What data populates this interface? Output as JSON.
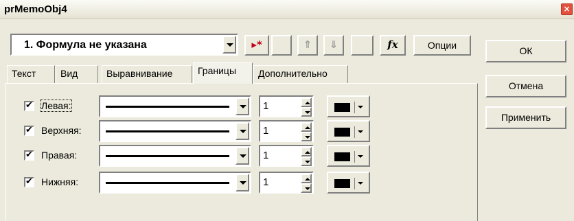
{
  "window": {
    "title": "prMemoObj4",
    "close_glyph": "×"
  },
  "formula": {
    "selected": "1.  Формула не указана"
  },
  "toolbar": {
    "buttons": [
      {
        "name": "insert-formula-icon",
        "glyph": "▸*"
      },
      {
        "name": "blank-button-1",
        "glyph": ""
      },
      {
        "name": "move-up-icon",
        "glyph": "⇑"
      },
      {
        "name": "move-down-icon",
        "glyph": "⇓"
      },
      {
        "name": "blank-button-2",
        "glyph": ""
      },
      {
        "name": "function-icon",
        "glyph": "fx"
      }
    ],
    "options_label": "Опции"
  },
  "side_buttons": {
    "ok": "ОК",
    "cancel": "Отмена",
    "apply": "Применить"
  },
  "tabs": [
    "Текст",
    "Вид",
    "Выравнивание",
    "Границы",
    "Дополнительно"
  ],
  "active_tab": "Границы",
  "borders": [
    {
      "label": "Левая:",
      "checked": true,
      "width": "1",
      "color": "#000000"
    },
    {
      "label": "Верхняя:",
      "checked": true,
      "width": "1",
      "color": "#000000"
    },
    {
      "label": "Правая:",
      "checked": true,
      "width": "1",
      "color": "#000000"
    },
    {
      "label": "Нижняя:",
      "checked": true,
      "width": "1",
      "color": "#000000"
    }
  ],
  "check_glyph": "✔"
}
